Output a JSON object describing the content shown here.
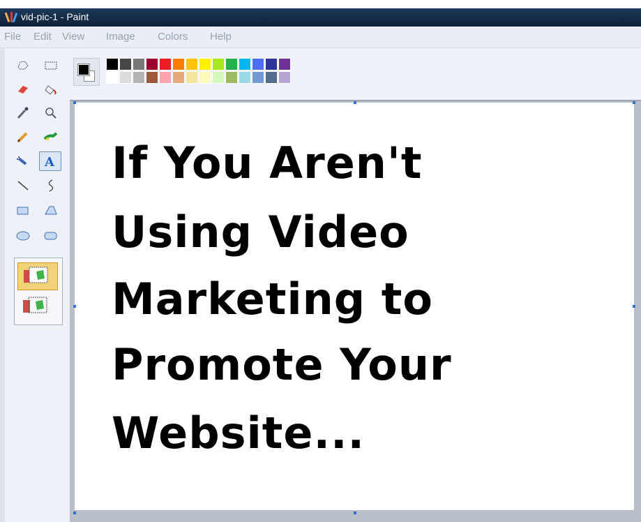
{
  "window": {
    "title": "vid-pic-1 - Paint",
    "app_icon": "paint-brush-icon"
  },
  "menu": [
    "File",
    "Edit",
    "View",
    "Image",
    "Colors",
    "Help"
  ],
  "tools": [
    {
      "name": "free-form-select-icon"
    },
    {
      "name": "rect-select-icon"
    },
    {
      "name": "eraser-icon"
    },
    {
      "name": "fill-bucket-icon"
    },
    {
      "name": "color-picker-icon"
    },
    {
      "name": "magnifier-icon"
    },
    {
      "name": "pencil-icon"
    },
    {
      "name": "brush-icon"
    },
    {
      "name": "airbrush-icon"
    },
    {
      "name": "text-tool-icon",
      "selected": true
    },
    {
      "name": "line-icon"
    },
    {
      "name": "curve-icon"
    },
    {
      "name": "rectangle-icon"
    },
    {
      "name": "polygon-icon"
    },
    {
      "name": "ellipse-icon"
    },
    {
      "name": "rounded-rect-icon"
    }
  ],
  "tool_options": {
    "opaque_icon": "opaque-background-icon",
    "transparent_icon": "transparent-background-icon",
    "selected": "opaque"
  },
  "palette": {
    "foreground": "#000000",
    "background": "#ffffff",
    "row1": [
      "#000000",
      "#464646",
      "#787878",
      "#990030",
      "#ed1c24",
      "#ff7e00",
      "#ffc20e",
      "#fff200",
      "#a8e61d",
      "#22b14c",
      "#00b7ef",
      "#4d6df3",
      "#2f3699",
      "#6f3198"
    ],
    "row2": [
      "#ffffff",
      "#dcdcdc",
      "#b4b4b4",
      "#9c5a3c",
      "#ffa3b1",
      "#e5aa7a",
      "#f5e49c",
      "#fff9bd",
      "#d3f9bc",
      "#9dbb61",
      "#99d9ea",
      "#709ad1",
      "#546d8e",
      "#b5a5d5"
    ]
  },
  "canvas": {
    "lines": [
      "If You Aren't",
      "Using Video",
      "Marketing to",
      "Promote Your",
      "Website..."
    ]
  }
}
